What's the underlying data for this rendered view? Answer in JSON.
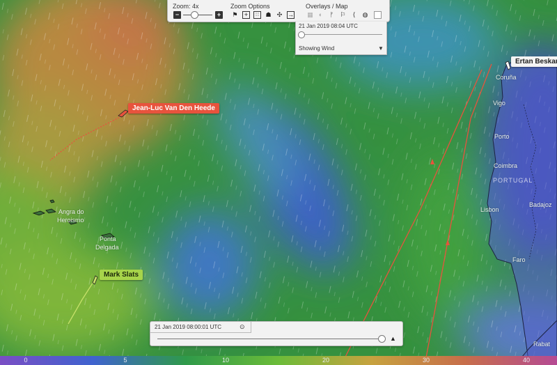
{
  "toolbar": {
    "zoom_label": "Zoom: 4x",
    "zoom_options_label": "Zoom Options",
    "overlays_label": "Overlays / Map",
    "zoom_out_icon": "minus-box-icon",
    "zoom_in_icon": "plus-box-icon"
  },
  "overlay_panel": {
    "date": "21 Jan 2019 08:04 UTC",
    "mode": "Showing Wind"
  },
  "time_slider": {
    "label": "21 Jan 2019 08:00:01 UTC",
    "position_fraction": 0.98
  },
  "boats": [
    {
      "name": "Jean-Luc Van Den Heede",
      "style": "red"
    },
    {
      "name": "Mark Slats",
      "style": "green"
    },
    {
      "name": "Ertan Beskan",
      "style": "white"
    }
  ],
  "places": {
    "angra": "Angra do",
    "heroismo": "Heroismo",
    "ponta": "Ponta",
    "delgada": "Delgada",
    "coruna": "Coruña",
    "vigo": "Vigo",
    "porto": "Porto",
    "coimbra": "Coimbra",
    "lisbon": "Lisbon",
    "badajoz": "Badajoz",
    "faro": "Faro",
    "rabat": "Rabat",
    "country": "PORTUGAL"
  },
  "legend": {
    "ticks": [
      "0",
      "5",
      "10",
      "20",
      "30",
      "40"
    ],
    "colors": [
      "#7a4ec4",
      "#3f63cf",
      "#2f9a4a",
      "#6cbc39",
      "#c7a23f",
      "#c76e4a",
      "#b54a93"
    ]
  }
}
